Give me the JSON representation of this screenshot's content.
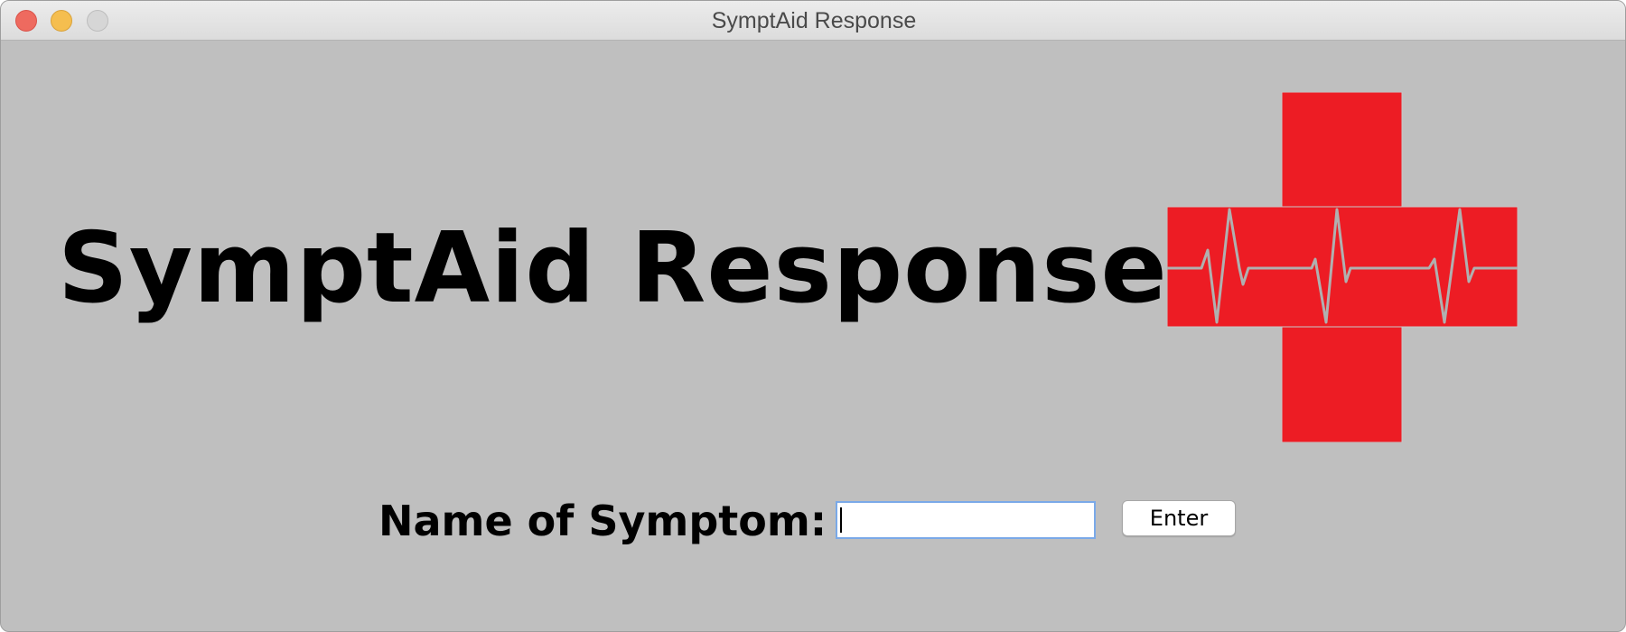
{
  "window": {
    "title": "SymptAid Response"
  },
  "app": {
    "title": "SymptAid Response"
  },
  "logo": {
    "icon": "medical-cross-heartbeat-icon",
    "cross_color": "#ed1c24",
    "line_color": "#a9a9a9"
  },
  "form": {
    "label": "Name of Symptom:",
    "input_value": "",
    "input_placeholder": "",
    "enter_label": "Enter"
  }
}
